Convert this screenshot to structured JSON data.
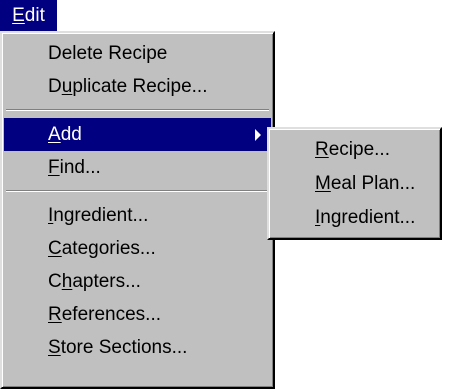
{
  "menubar": {
    "edit": {
      "label": "Edit",
      "access_key": "E",
      "rest": "dit"
    }
  },
  "edit_menu": {
    "items": [
      {
        "label": "Delete Recipe"
      },
      {
        "label": "Duplicate Recipe...",
        "pre": "D",
        "key": "u",
        "post": "plicate Recipe..."
      },
      {
        "label": "Add",
        "pre": "",
        "key": "A",
        "post": "dd",
        "has_submenu": true,
        "highlighted": true
      },
      {
        "label": "Find...",
        "pre": "",
        "key": "F",
        "post": "ind..."
      },
      {
        "label": "Ingredient...",
        "pre": "",
        "key": "I",
        "post": "ngredient..."
      },
      {
        "label": "Categories...",
        "pre": "",
        "key": "C",
        "post": "ategories..."
      },
      {
        "label": "Chapters...",
        "pre": "C",
        "key": "h",
        "post": "apters..."
      },
      {
        "label": "References...",
        "pre": "",
        "key": "R",
        "post": "eferences..."
      },
      {
        "label": "Store Sections...",
        "pre": "",
        "key": "S",
        "post": "tore Sections..."
      }
    ]
  },
  "add_submenu": {
    "items": [
      {
        "label": "Recipe...",
        "pre": "",
        "key": "R",
        "post": "ecipe..."
      },
      {
        "label": "Meal Plan...",
        "pre": "",
        "key": "M",
        "post": "eal Plan..."
      },
      {
        "label": "Ingredient...",
        "pre": "",
        "key": "I",
        "post": "ngredient..."
      }
    ]
  },
  "colors": {
    "menu_face": "#c0c0c0",
    "highlight": "#000080",
    "highlight_text": "#ffffff",
    "text": "#000000"
  },
  "icons": {
    "submenu_arrow": "submenu-arrow-icon"
  }
}
